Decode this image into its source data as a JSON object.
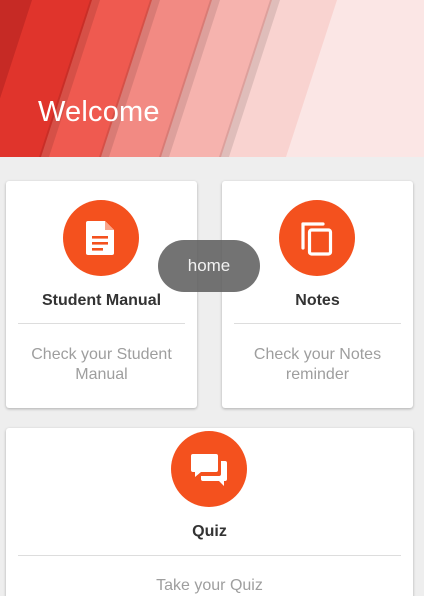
{
  "header": {
    "title": "Welcome"
  },
  "cards": [
    {
      "title": "Student Manual",
      "description": "Check your Student Manual",
      "icon": "document-icon"
    },
    {
      "title": "Notes",
      "description": "Check your Notes reminder",
      "icon": "copy-pages-icon"
    },
    {
      "title": "Quiz",
      "description": "Take your Quiz",
      "icon": "chat-bubbles-icon"
    }
  ],
  "toast": {
    "text": "home"
  },
  "colors": {
    "accent": "#f4511e",
    "header_red": "#e0342c",
    "card_bg": "#ffffff",
    "page_bg": "#eeeeee"
  }
}
